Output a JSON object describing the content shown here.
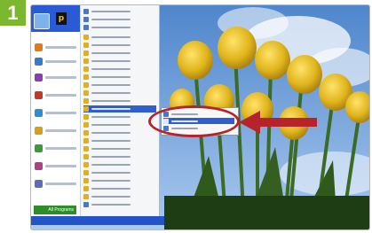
{
  "step_number": "1",
  "notification_badge": "p",
  "all_programs_label": "All Programs",
  "colors": {
    "accent_green": "#7cb82f",
    "highlight_red": "#b7232b",
    "xp_blue": "#2a5bd7",
    "selection_blue": "#2f5fcf"
  },
  "icons": [
    "avatar-icon",
    "program-icon",
    "folder-icon",
    "arrow-icon"
  ]
}
